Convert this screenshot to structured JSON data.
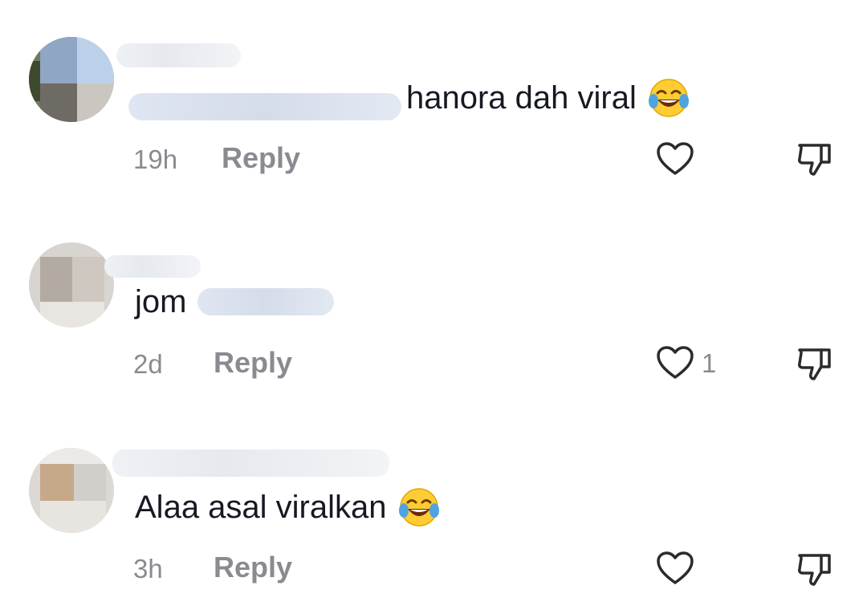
{
  "comments": [
    {
      "text": "hanora dah viral",
      "has_mention": true,
      "has_emoji": true,
      "emoji_name": "face-with-tears-of-joy",
      "time": "19h",
      "reply_label": "Reply",
      "like_count": ""
    },
    {
      "text": "jom",
      "has_mention": true,
      "has_emoji": false,
      "time": "2d",
      "reply_label": "Reply",
      "like_count": "1"
    },
    {
      "text": "Alaa asal viralkan",
      "has_mention": false,
      "has_emoji": true,
      "emoji_name": "face-with-tears-of-joy",
      "time": "3h",
      "reply_label": "Reply",
      "like_count": ""
    }
  ],
  "icons": {
    "like": "heart-outline-icon",
    "dislike": "thumbs-down-outline-icon"
  },
  "colors": {
    "text": "#161823",
    "meta": "#8a8b91",
    "icon": "#2b2b2b",
    "emoji_face": "#ffcc33",
    "emoji_tears": "#4fa3e0"
  }
}
